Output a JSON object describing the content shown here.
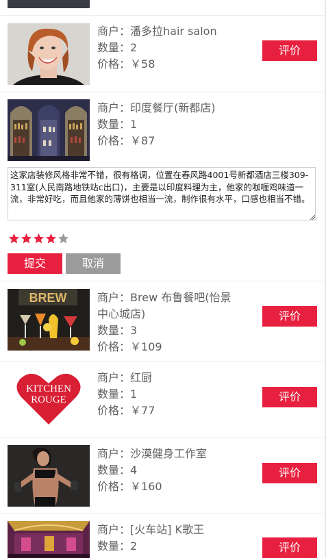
{
  "labels": {
    "merchant": "商户：",
    "quantity": "数量：",
    "price": "价格：￥",
    "review_button": "评价"
  },
  "orders": [
    {
      "merchant": "潘多拉hair salon",
      "quantity": "2",
      "price": "58",
      "thumb": "woman-portrait"
    },
    {
      "merchant": "印度餐厅(新都店)",
      "quantity": "1",
      "price": "87",
      "thumb": "restaurant-shelves"
    },
    {
      "merchant": "Brew 布鲁餐吧(怡景中心城店)",
      "merchant_line1": "Brew 布鲁餐吧(怡景",
      "merchant_line2": "中心城店)",
      "quantity": "3",
      "price": "109",
      "thumb": "cocktails-brew"
    },
    {
      "merchant": "红厨",
      "quantity": "1",
      "price": "77",
      "thumb": "kitchen-rouge-logo"
    },
    {
      "merchant": "沙漠健身工作室",
      "quantity": "4",
      "price": "160",
      "thumb": "fitness-woman"
    },
    {
      "merchant": "[火车站] K歌王",
      "quantity": "2",
      "thumb": "ktv-room"
    }
  ],
  "review_form": {
    "text": "这家店装修风格非常不错，很有格调，位置在春风路4001号新都酒店三楼309-311室(人民南路地铁站c出口)，主要是以印度料理为主，他家的咖喱鸡味道一流，非常好吃，而且他家的薄饼也相当一流，制作很有水平，口感也相当不错。",
    "rating": 4,
    "max_rating": 5,
    "submit_label": "提交",
    "cancel_label": "取消"
  },
  "logo_text": {
    "line1": "KITCHEN",
    "line2": "ROUGE"
  },
  "thumb_text": {
    "brew": "BREW"
  },
  "colors": {
    "accent": "#e8203f",
    "cancel": "#9b9b9b",
    "star_on": "#e8203f",
    "star_off": "#9b9b9b"
  }
}
